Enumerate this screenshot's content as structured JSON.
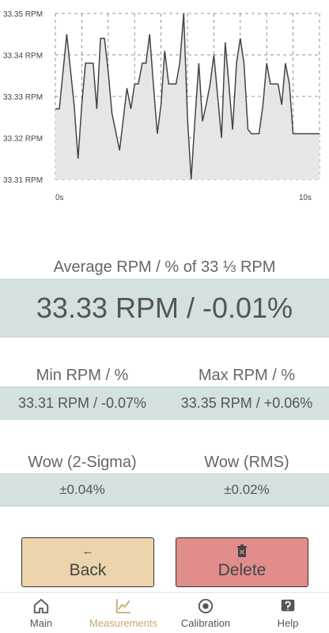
{
  "chart_data": {
    "type": "area",
    "y_tick_labels": [
      "33.35 RPM",
      "33.34 RPM",
      "33.33 RPM",
      "33.32 RPM",
      "33.31 RPM"
    ],
    "y_ticks": [
      33.35,
      33.34,
      33.33,
      33.32,
      33.31
    ],
    "x_tick_labels": [
      "0s",
      "10s"
    ],
    "ylim": [
      33.31,
      33.35
    ],
    "xlim": [
      0,
      10
    ],
    "grid": true,
    "x": [
      0,
      0.15,
      0.43,
      0.71,
      0.86,
      1.0,
      1.14,
      1.43,
      1.57,
      1.71,
      1.86,
      2.0,
      2.14,
      2.43,
      2.71,
      2.86,
      3.0,
      3.14,
      3.29,
      3.43,
      3.57,
      3.71,
      3.86,
      4.0,
      4.14,
      4.29,
      4.43,
      4.57,
      4.71,
      4.86,
      5.0,
      5.14,
      5.29,
      5.43,
      5.57,
      5.71,
      5.86,
      6.0,
      6.29,
      6.43,
      6.57,
      6.71,
      6.86,
      7.0,
      7.14,
      7.29,
      7.43,
      7.57,
      7.71,
      7.86,
      8.0,
      8.14,
      8.29,
      8.43,
      8.57,
      8.71,
      8.86,
      9.0,
      9.14,
      9.29,
      9.43,
      9.57,
      9.71,
      9.86,
      10.0
    ],
    "y": [
      33.327,
      33.327,
      33.345,
      33.328,
      33.315,
      33.328,
      33.338,
      33.338,
      33.327,
      33.344,
      33.344,
      33.336,
      33.326,
      33.317,
      33.332,
      33.327,
      33.333,
      33.333,
      33.338,
      33.338,
      33.345,
      33.333,
      33.321,
      33.328,
      33.341,
      33.333,
      33.333,
      33.333,
      33.338,
      33.35,
      33.325,
      33.31,
      33.325,
      33.338,
      33.324,
      33.328,
      33.333,
      33.34,
      33.32,
      33.343,
      33.333,
      33.322,
      33.338,
      33.344,
      33.338,
      33.322,
      33.321,
      33.321,
      33.321,
      33.328,
      33.338,
      33.333,
      33.333,
      33.333,
      33.328,
      33.338,
      33.333,
      33.321,
      33.321,
      33.321,
      33.321,
      33.321,
      33.321,
      33.321,
      33.321
    ]
  },
  "average": {
    "label": "Average RPM / % of 33 ⅓ RPM",
    "value": "33.33 RPM / -0.01%"
  },
  "min": {
    "label": "Min RPM / %",
    "value": "33.31 RPM / -0.07%"
  },
  "max": {
    "label": "Max RPM / %",
    "value": "33.35 RPM / +0.06%"
  },
  "wow_2sigma": {
    "label": "Wow (2-Sigma)",
    "value": "±0.04%"
  },
  "wow_rms": {
    "label": "Wow (RMS)",
    "value": "±0.02%"
  },
  "buttons": {
    "back": {
      "label": "Back",
      "icon": "←",
      "color": "#ecd5ac"
    },
    "delete": {
      "label": "Delete",
      "icon": "🗑",
      "color": "#e08d8b"
    }
  },
  "nav": {
    "main": "Main",
    "measurements": "Measurements",
    "calibration": "Calibration",
    "help": "Help",
    "active_color": "#c9a86b"
  }
}
